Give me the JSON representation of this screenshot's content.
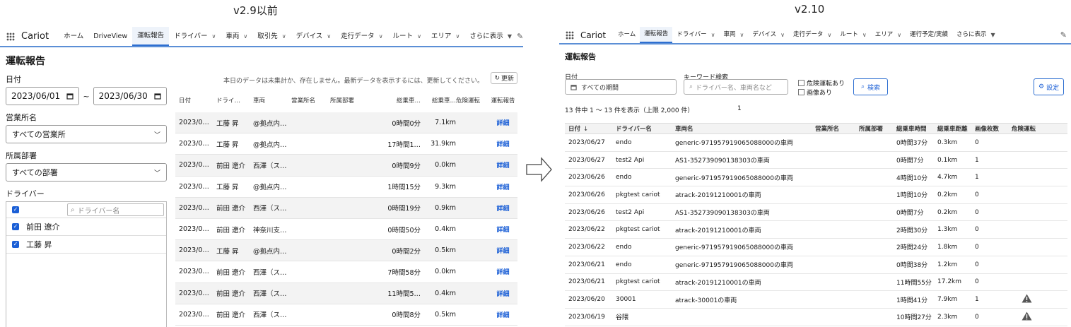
{
  "versions": {
    "left": "v2.9以前",
    "right": "v2.10"
  },
  "icons": {
    "app_launcher": "waffle-icon",
    "edit": "pencil-icon",
    "calendar": "calendar-icon",
    "search": "magnifier-icon",
    "settings": "gear-icon",
    "warning": "warning-triangle-icon",
    "refresh": "refresh-icon",
    "sort": "arrow-down-icon",
    "flow": "right-arrow-icon"
  },
  "colors": {
    "accent": "#2e6fd1",
    "nav_border": "#5c8fd6",
    "link": "#1b5fd6",
    "warning": "#555555"
  },
  "old_ui": {
    "brand": "Cariot",
    "nav": [
      "ホーム",
      "DriveView",
      "運転報告",
      "ドライバー",
      "車両",
      "取引先",
      "デバイス",
      "走行データ",
      "ルート",
      "エリア",
      "さらに表示"
    ],
    "nav_dropdown": [
      false,
      false,
      false,
      true,
      true,
      true,
      true,
      true,
      true,
      true,
      true
    ],
    "active_nav_index": 2,
    "page_title": "運転報告",
    "filters": {
      "date_label": "日付",
      "date_from": "2023/06/01",
      "date_to": "2023/06/30",
      "tilde": "~",
      "office_label": "営業所名",
      "office_value": "すべての営業所",
      "dept_label": "所属部署",
      "dept_value": "すべての部署",
      "driver_label": "ドライバー",
      "driver_search_placeholder": "ドライバー名",
      "drivers": [
        "前田 遼介",
        "工藤 昇"
      ]
    },
    "notice": "本日のデータは未集計か、存在しません。最新データを表示するには、更新してください。",
    "refresh_label": "更新",
    "columns": [
      "日付",
      "ドライ…",
      "車両",
      "営業所名",
      "所属部署",
      "総乗車…",
      "総乗車…",
      "危険運転",
      "運転報告"
    ],
    "detail_label": "詳細",
    "rows": [
      [
        "2023/0…",
        "工藤 昇",
        "@拠点内…",
        "",
        "",
        "0時間0分",
        "7.1km",
        ""
      ],
      [
        "2023/0…",
        "工藤 昇",
        "@拠点内…",
        "",
        "",
        "17時間1…",
        "31.9km",
        ""
      ],
      [
        "2023/0…",
        "前田 遼介",
        "西澤（ス…",
        "",
        "",
        "0時間9分",
        "0.0km",
        ""
      ],
      [
        "2023/0…",
        "工藤 昇",
        "@拠点内…",
        "",
        "",
        "1時間15分",
        "9.3km",
        ""
      ],
      [
        "2023/0…",
        "前田 遼介",
        "西澤（ス…",
        "",
        "",
        "0時間19分",
        "0.9km",
        ""
      ],
      [
        "2023/0…",
        "前田 遼介",
        "神奈川支…",
        "",
        "",
        "0時間50分",
        "0.4km",
        ""
      ],
      [
        "2023/0…",
        "工藤 昇",
        "@拠点内…",
        "",
        "",
        "0時間2分",
        "0.5km",
        ""
      ],
      [
        "2023/0…",
        "前田 遼介",
        "西澤（ス…",
        "",
        "",
        "7時間58分",
        "0.0km",
        ""
      ],
      [
        "2023/0…",
        "前田 遼介",
        "西澤（ス…",
        "",
        "",
        "11時間5…",
        "0.4km",
        ""
      ],
      [
        "2023/0…",
        "前田 遼介",
        "西澤（ス…",
        "",
        "",
        "0時間8分",
        "0.5km",
        ""
      ]
    ]
  },
  "new_ui": {
    "brand": "Cariot",
    "nav": [
      "ホーム",
      "運転報告",
      "ドライバー",
      "車両",
      "デバイス",
      "走行データ",
      "ルート",
      "エリア",
      "運行予定/実績",
      "さらに表示"
    ],
    "nav_dropdown": [
      false,
      false,
      true,
      true,
      true,
      true,
      true,
      true,
      false,
      true
    ],
    "active_nav_index": 1,
    "page_title": "運転報告",
    "date_label": "日付",
    "date_value": "すべての期間",
    "keyword_label": "キーワード検索",
    "keyword_placeholder": "ドライバー名、車両名など",
    "check_danger": "危険運転あり",
    "check_image": "画像あり",
    "search_button": "検索",
    "settings_button": "設定",
    "count_text": "13 件中 1 ～ 13 件を表示（上限 2,000 件）",
    "page_number": "1",
    "columns": [
      "日付",
      "ドライバー名",
      "車両名",
      "営業所名",
      "所属部署",
      "総乗車時間",
      "総乗車距離",
      "画像枚数",
      "危険運転"
    ],
    "sort_indicator": "↓",
    "rows": [
      {
        "date": "2023/06/27",
        "driver": "endo",
        "vehicle": "generic-971957919065088000の車両",
        "office": "",
        "dept": "",
        "time": "0時間37分",
        "distance": "0.3km",
        "images": "0",
        "danger": false
      },
      {
        "date": "2023/06/27",
        "driver": "test2 Api",
        "vehicle": "AS1-352739090138303の車両",
        "office": "",
        "dept": "",
        "time": "0時間7分",
        "distance": "0.1km",
        "images": "1",
        "danger": false
      },
      {
        "date": "2023/06/26",
        "driver": "endo",
        "vehicle": "generic-971957919065088000の車両",
        "office": "",
        "dept": "",
        "time": "4時間10分",
        "distance": "4.7km",
        "images": "1",
        "danger": false
      },
      {
        "date": "2023/06/26",
        "driver": "pkgtest cariot",
        "vehicle": "atrack-20191210001の車両",
        "office": "",
        "dept": "",
        "time": "1時間10分",
        "distance": "0.2km",
        "images": "0",
        "danger": false
      },
      {
        "date": "2023/06/26",
        "driver": "test2 Api",
        "vehicle": "AS1-352739090138303の車両",
        "office": "",
        "dept": "",
        "time": "0時間7分",
        "distance": "0.2km",
        "images": "0",
        "danger": false
      },
      {
        "date": "2023/06/22",
        "driver": "pkgtest cariot",
        "vehicle": "atrack-20191210001の車両",
        "office": "",
        "dept": "",
        "time": "2時間30分",
        "distance": "1.3km",
        "images": "0",
        "danger": false
      },
      {
        "date": "2023/06/22",
        "driver": "endo",
        "vehicle": "generic-971957919065088000の車両",
        "office": "",
        "dept": "",
        "time": "2時間24分",
        "distance": "1.8km",
        "images": "0",
        "danger": false
      },
      {
        "date": "2023/06/21",
        "driver": "endo",
        "vehicle": "generic-971957919065088000の車両",
        "office": "",
        "dept": "",
        "time": "0時間38分",
        "distance": "1.2km",
        "images": "0",
        "danger": false
      },
      {
        "date": "2023/06/21",
        "driver": "pkgtest cariot",
        "vehicle": "atrack-20191210001の車両",
        "office": "",
        "dept": "",
        "time": "11時間55分",
        "distance": "17.2km",
        "images": "0",
        "danger": false
      },
      {
        "date": "2023/06/20",
        "driver": "30001",
        "vehicle": "atrack-30001の車両",
        "office": "",
        "dept": "",
        "time": "1時間41分",
        "distance": "7.9km",
        "images": "1",
        "danger": true
      },
      {
        "date": "2023/06/19",
        "driver": "谷隈",
        "vehicle": "",
        "office": "",
        "dept": "",
        "time": "10時間27分",
        "distance": "2.3km",
        "images": "0",
        "danger": true
      }
    ]
  }
}
